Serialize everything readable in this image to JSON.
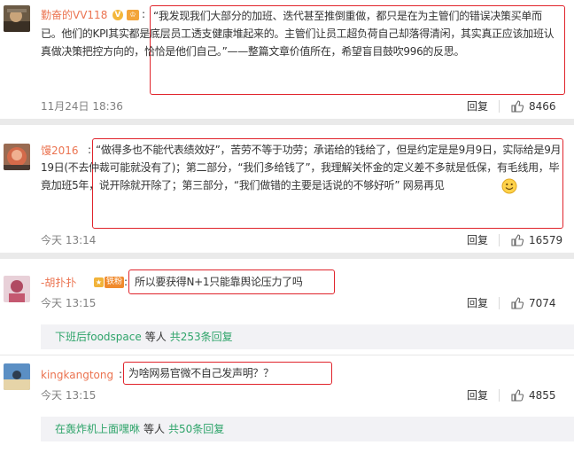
{
  "comments": [
    {
      "username": "勤奋的VV118",
      "text": "“我发现我们大部分的加班、迭代甚至推倒重做，都只是在为主管们的错误决策买单而已。他们的KPI其实都是底层员工透支健康堆起来的。主管们让员工超负荷自己却落得清闲，其实真正应该加班认真做决策把控方向的，恰恰是他们自己。”——整篇文章价值所在，希望盲目鼓吹996的反思。",
      "time": "11月24日 18:36",
      "reply_label": "回复",
      "like_count": "8466"
    },
    {
      "username": "馒2016",
      "text": "“做得多也不能代表绩效好”，苦劳不等于功劳；承诺给的钱给了，但是约定是是9月9日，实际给是9月19日(不去仲裁可能就没有了)；第二部分，“我们多给钱了”，我理解关怀金的定义差不多就是低保，有毛线用，毕竟加班5年，说开除就开除了；第三部分，“我们做错的主要是话说的不够好听” 网易再见",
      "time": "今天 13:14",
      "reply_label": "回复",
      "like_count": "16579"
    },
    {
      "username": "-胡扑扑",
      "badge": "铁粉",
      "text": "所以要获得N+1只能靠舆论压力了吗",
      "time": "今天 13:15",
      "reply_label": "回复",
      "like_count": "7074",
      "replies_summary": {
        "user": "下班后foodspace",
        "mid": "等人",
        "count": "共253条回复"
      }
    },
    {
      "username": "kingkangtong",
      "text": "为啥网易官微不自己发声明？？",
      "time": "今天 13:15",
      "reply_label": "回复",
      "like_count": "4855",
      "replies_summary": {
        "user": "在轰炸机上面嘿咻",
        "mid": "等人",
        "count": "共50条回复"
      }
    }
  ],
  "icons": [
    "v-badge-icon",
    "crown-icon",
    "thumbs-up-icon",
    "smile-emoji-icon"
  ],
  "colors": {
    "username": "#eb7350",
    "highlight_box": "#e0232b",
    "replies_link": "#2fa46a"
  }
}
